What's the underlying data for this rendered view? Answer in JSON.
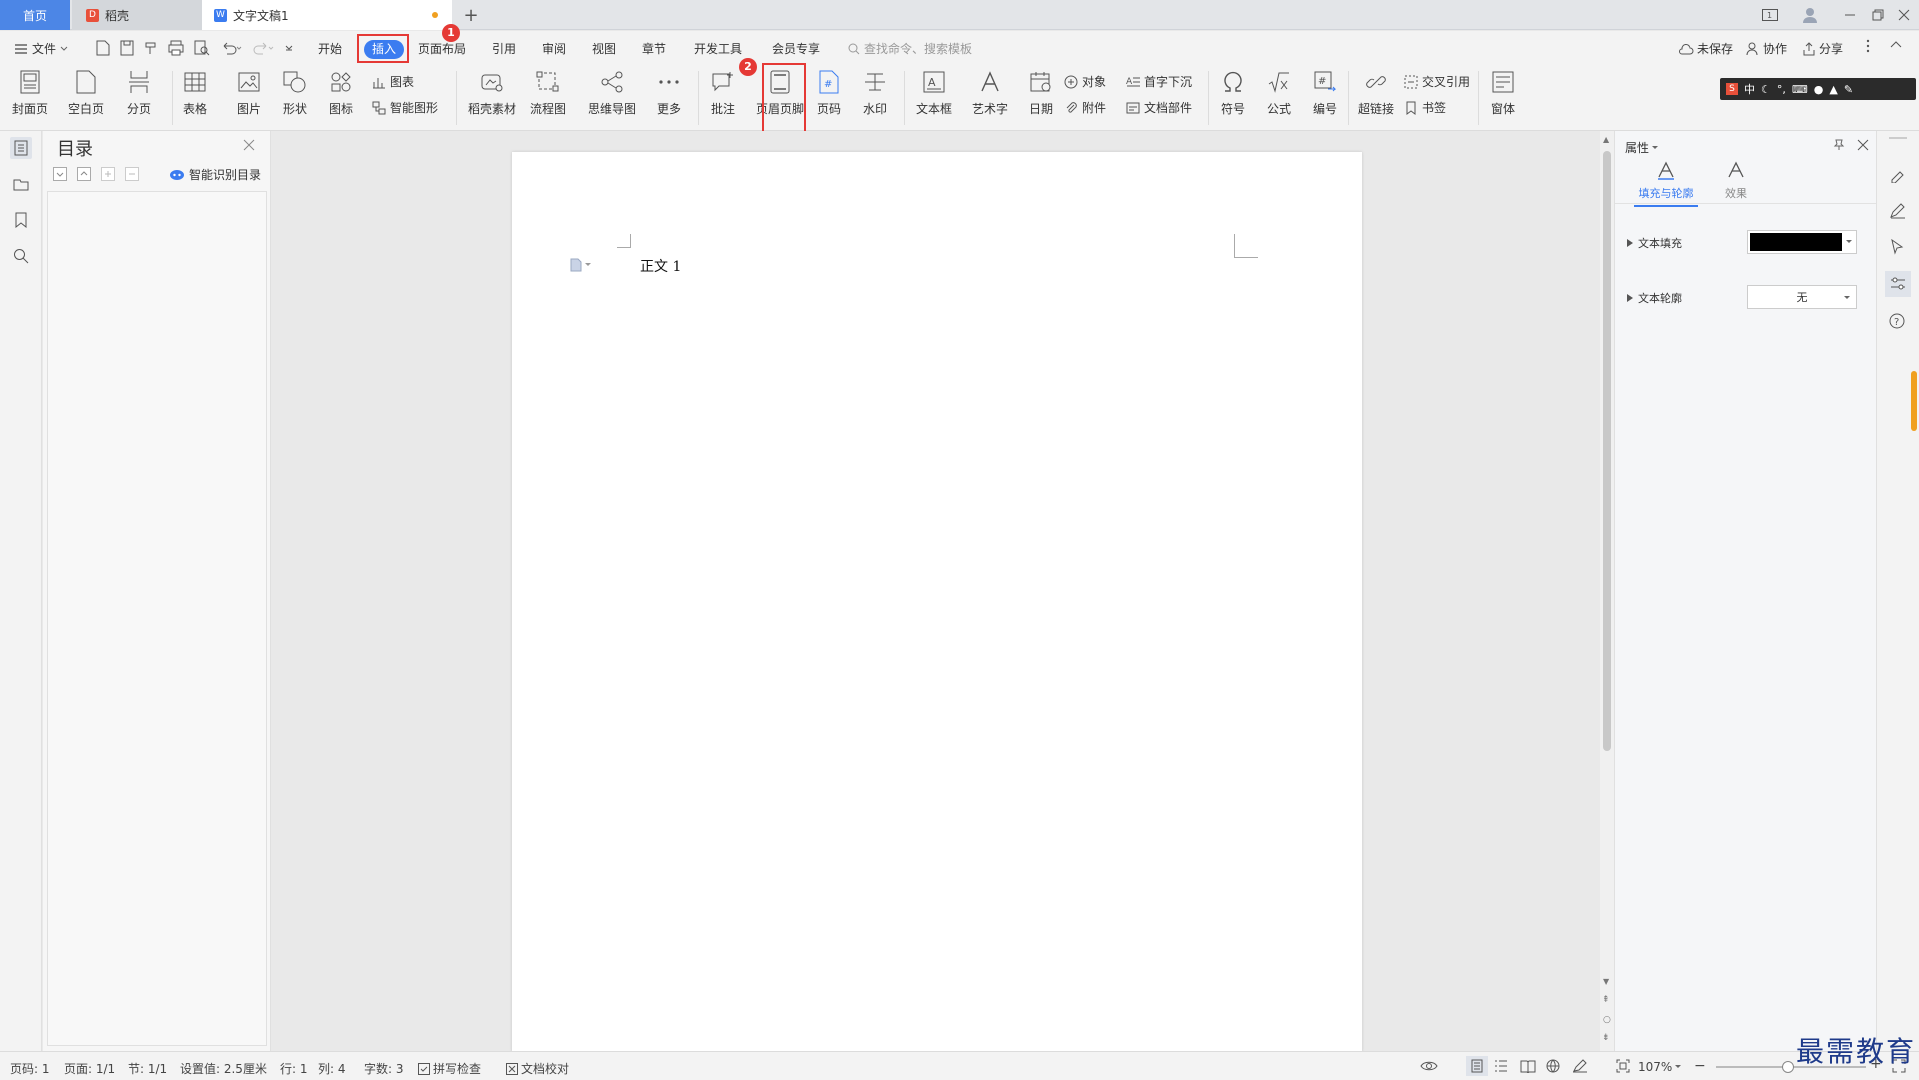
{
  "titlebar": {
    "tabs": [
      {
        "label": "首页"
      },
      {
        "label": "稻壳"
      },
      {
        "label": "文字文稿1"
      }
    ],
    "new_tab": "+"
  },
  "menu": {
    "file": "文件",
    "items": [
      "开始",
      "插入",
      "页面布局",
      "引用",
      "审阅",
      "视图",
      "章节",
      "开发工具",
      "会员专享"
    ],
    "search_placeholder": "查找命令、搜索模板",
    "unsaved": "未保存",
    "collab": "协作",
    "share": "分享",
    "badge1": "1",
    "badge2": "2"
  },
  "ribbon": {
    "cover": "封面页",
    "blank": "空白页",
    "pagebreak": "分页",
    "table": "表格",
    "picture": "图片",
    "shape": "形状",
    "icon": "图标",
    "chart": "图表",
    "smartart": "智能图形",
    "daoke": "稻壳素材",
    "flow": "流程图",
    "mindmap": "思维导图",
    "more": "更多",
    "comment": "批注",
    "headerfooter": "页眉页脚",
    "pagenum": "页码",
    "watermark": "水印",
    "textbox": "文本框",
    "wordart": "艺术字",
    "date": "日期",
    "object": "对象",
    "attach": "附件",
    "dropcap": "首字下沉",
    "docpart": "文档部件",
    "symbol": "符号",
    "formula": "公式",
    "number": "编号",
    "hyperlink": "超链接",
    "crossref": "交叉引用",
    "bookmark": "书签",
    "window": "窗体"
  },
  "toc": {
    "title": "目录",
    "smart": "智能识别目录"
  },
  "document": {
    "body_text": "正文 1"
  },
  "properties": {
    "title": "属性",
    "tab_fill": "填充与轮廓",
    "tab_effect": "效果",
    "text_fill": "文本填充",
    "text_outline": "文本轮廓",
    "outline_value": "无",
    "fill_color": "#000000",
    "accent": "#3b7cf0"
  },
  "status": {
    "pagenum": "页码: 1",
    "page": "页面: 1/1",
    "section": "节: 1/1",
    "setting": "设置值: 2.5厘米",
    "row": "行: 1",
    "col": "列: 4",
    "wordcount": "字数: 3",
    "spell": "拼写检查",
    "proof": "文档校对",
    "zoom": "107%"
  },
  "watermark_text": "最需教育"
}
